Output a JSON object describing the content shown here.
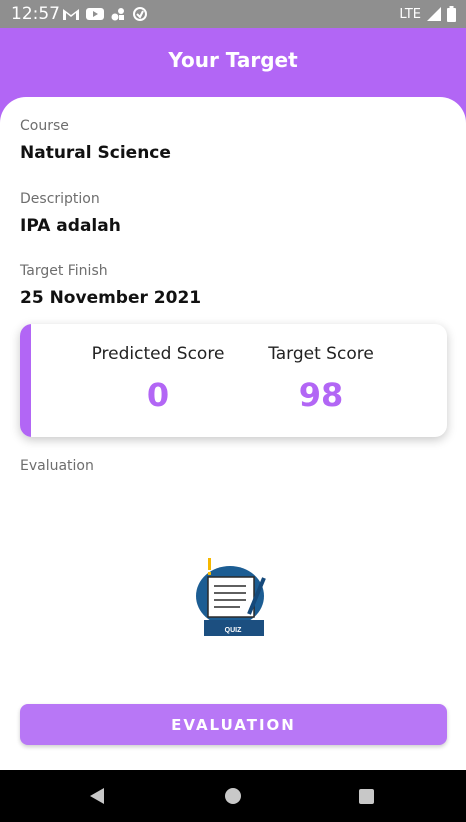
{
  "status_bar": {
    "time": "12:57",
    "network": "LTE",
    "icons": [
      "gmail-icon",
      "youtube-icon",
      "settings-icon",
      "sync-icon",
      "signal-icon",
      "battery-icon"
    ]
  },
  "header": {
    "title": "Your Target"
  },
  "course": {
    "label": "Course",
    "value": "Natural Science"
  },
  "description": {
    "label": "Description",
    "value": "IPA adalah"
  },
  "target_finish": {
    "label": "Target Finish",
    "value": "25 November 2021"
  },
  "scores": {
    "predicted_label": "Predicted Score",
    "predicted_value": "0",
    "target_label": "Target Score",
    "target_value": "98"
  },
  "evaluation": {
    "label": "Evaluation",
    "illustration_text": "QUIZ",
    "button_label": "EVALUATION"
  },
  "colors": {
    "accent": "#b266f5",
    "button": "#b877f6"
  }
}
